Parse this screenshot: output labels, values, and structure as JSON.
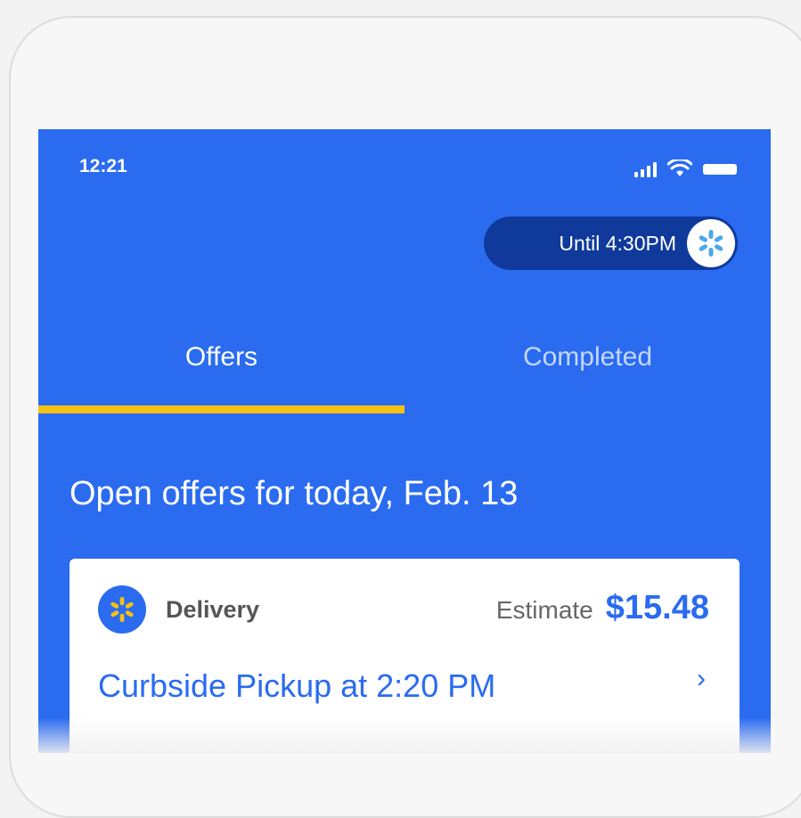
{
  "status_bar": {
    "time": "12:21",
    "icons": [
      "signal-icon",
      "wifi-icon",
      "battery-icon"
    ]
  },
  "shift_pill": {
    "label": "Until 4:30PM",
    "icon": "spark-icon"
  },
  "tabs": [
    {
      "label": "Offers",
      "active": true
    },
    {
      "label": "Completed",
      "active": false
    }
  ],
  "section_heading": "Open offers for today, Feb. 13",
  "offer": {
    "type": "Delivery",
    "estimate_label": "Estimate",
    "estimate_value": "$15.48",
    "title": "Curbside Pickup at 2:20 PM",
    "chevron": "›"
  },
  "colors": {
    "brand_blue": "#2a6bf0",
    "pill_dark": "#0f3a9c",
    "tab_indicator": "#f5c116"
  }
}
